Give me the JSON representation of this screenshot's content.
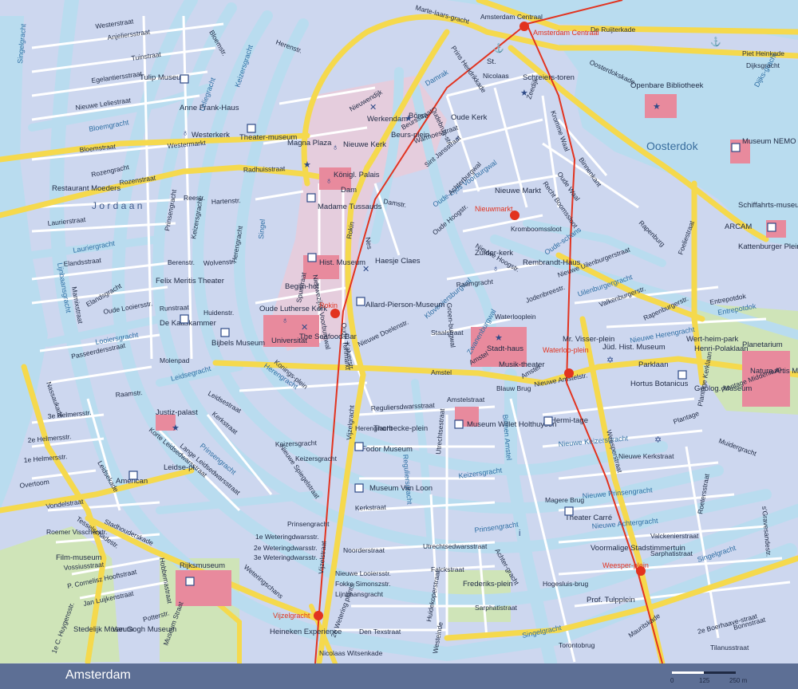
{
  "map_title": "Amsterdam",
  "colors": {
    "water": "#b9dcef",
    "block": "#cdd7ef",
    "street": "#ffffff",
    "main_road": "#f5d94d",
    "tram": "#e2331f",
    "park": "#cfe4b8",
    "landmark": "#e88a9d",
    "pedestrian": "#f0c9d6",
    "footer": "#5d6f95"
  },
  "scale": {
    "zero": "0",
    "mid": "125",
    "end": "250 m"
  },
  "districts": [
    {
      "id": "jordaan",
      "label": "J o r d a a n"
    },
    {
      "id": "oosterdok",
      "label": "Oosterdok"
    }
  ],
  "waterways": [
    {
      "id": "singelgracht-w",
      "label": "Singelgracht"
    },
    {
      "id": "lijnbaansgracht-w",
      "label": "Lijnbaansgracht"
    },
    {
      "id": "bloemgracht",
      "label": "Bloemgracht"
    },
    {
      "id": "lauriergracht",
      "label": "Lauriergracht"
    },
    {
      "id": "looiersgracht",
      "label": "Looiersgracht"
    },
    {
      "id": "leidsegracht",
      "label": "Leidsegracht"
    },
    {
      "id": "keizersgracht-w",
      "label": "Keizersgracht"
    },
    {
      "id": "prinsengracht-w",
      "label": "Prinsengracht"
    },
    {
      "id": "herengracht-w",
      "label": "Herengracht"
    },
    {
      "id": "singel",
      "label": "Singel"
    },
    {
      "id": "leliegracht",
      "label": "Leliegracht"
    },
    {
      "id": "damrak",
      "label": "Damrak"
    },
    {
      "id": "oz-voorburgwal",
      "label": "Oude-zijds Voorburgwal"
    },
    {
      "id": "kloveniersburgwal",
      "label": "Kloveniersburgwal"
    },
    {
      "id": "zwanenburgwal",
      "label": "Zwanenburgwal"
    },
    {
      "id": "binnenamstel",
      "label": "Binnen Amstel"
    },
    {
      "id": "reguliersgracht",
      "label": "Reguliersgracht"
    },
    {
      "id": "keizersgracht-e",
      "label": "Keizersgracht"
    },
    {
      "id": "prinsengracht-e",
      "label": "Prinsengracht"
    },
    {
      "id": "nieuwe-keizersgracht",
      "label": "Nieuwe Keizersgracht"
    },
    {
      "id": "nieuwe-prinsengracht",
      "label": "Nieuwe Prinsengracht"
    },
    {
      "id": "nieuwe-herengracht",
      "label": "Nieuwe Herengracht"
    },
    {
      "id": "nieuwe-achtergracht",
      "label": "Nieuwe Achtergracht"
    },
    {
      "id": "singelgracht-s",
      "label": "Singelgracht"
    },
    {
      "id": "singelgracht-e",
      "label": "Singelgracht"
    },
    {
      "id": "uilenburgergracht",
      "label": "Uilenburgergracht"
    },
    {
      "id": "entrepotdok",
      "label": "Entrepotdok"
    },
    {
      "id": "oudeschans",
      "label": "Oude-schans"
    },
    {
      "id": "dijksgracht",
      "label": "Dijks-gracht"
    }
  ],
  "streets": [
    {
      "id": "westerstraat",
      "label": "Westerstraat"
    },
    {
      "id": "anjeliersstraat",
      "label": "Anjeliersstraat"
    },
    {
      "id": "tuinstraat",
      "label": "Tuinstraat"
    },
    {
      "id": "egelantiersstraat",
      "label": "Egelantiersstraat"
    },
    {
      "id": "nieuwe-leliestraat",
      "label": "Nieuwe Leliestraat"
    },
    {
      "id": "bloemstraat",
      "label": "Bloemstraat"
    },
    {
      "id": "rozengracht",
      "label": "Rozengracht"
    },
    {
      "id": "rozenstraat",
      "label": "Rozenstraat"
    },
    {
      "id": "westermarkt",
      "label": "Westermarkt"
    },
    {
      "id": "radhuisstraat",
      "label": "Radhuisstraat"
    },
    {
      "id": "laurierstraat",
      "label": "Laurierstraat"
    },
    {
      "id": "elandsstraat",
      "label": "Elandsstraat"
    },
    {
      "id": "elandsgracht",
      "label": "Elandsgracht"
    },
    {
      "id": "oude-looiersstr",
      "label": "Oude Looiersstr."
    },
    {
      "id": "passeerdersstraat",
      "label": "Passeerdersstraat"
    },
    {
      "id": "marnixstraat",
      "label": "Marnixstraat"
    },
    {
      "id": "nassaukade",
      "label": "Nassaukade"
    },
    {
      "id": "overtoom",
      "label": "Overtoom"
    },
    {
      "id": "vondelstraat",
      "label": "Vondelstraat"
    },
    {
      "id": "tesselschadestr",
      "label": "Tesselschadestr."
    },
    {
      "id": "roemer-visscherstr",
      "label": "Roemer Visscherstr."
    },
    {
      "id": "vossiusstraat",
      "label": "Vossiusstraat"
    },
    {
      "id": "hooftstraat",
      "label": "P. Cornelisz Hooftstraat"
    },
    {
      "id": "luijkenstraat",
      "label": "Jan Luijkenstraat"
    },
    {
      "id": "potterstr",
      "label": "Potterstr."
    },
    {
      "id": "hobbemastraat",
      "label": "Hobbemastraat"
    },
    {
      "id": "stadhouderskade",
      "label": "Stadhouderskade"
    },
    {
      "id": "weteringschans",
      "label": "Weteringschans"
    },
    {
      "id": "museumstraat",
      "label": "Museum Straat"
    },
    {
      "id": "huygensstr",
      "label": "1e C. Huygensstr."
    },
    {
      "id": "helmerstr-3",
      "label": "3e Helmersstr."
    },
    {
      "id": "helmerstr-2",
      "label": "2e Helmersstr."
    },
    {
      "id": "helmerstr-1",
      "label": "1e Helmersstr."
    },
    {
      "id": "leidsekade",
      "label": "Leidsekade"
    },
    {
      "id": "korte-leidsedwarsstraat",
      "label": "Korte Leidsedwarsstraat"
    },
    {
      "id": "lange-leidsedwarsstraat",
      "label": "Lange Leidsedwarsstraat"
    },
    {
      "id": "kerkstraat-w",
      "label": "Kerkstraat"
    },
    {
      "id": "leidsestraat",
      "label": "Leidsestraat"
    },
    {
      "id": "nieuwe-spiegelstraat",
      "label": "Nieuwe Spiegelstraat"
    },
    {
      "id": "keizersgracht-street",
      "label": "Keizersgracht"
    },
    {
      "id": "molenpad",
      "label": "Molenpad"
    },
    {
      "id": "raamstr",
      "label": "Raamstr."
    },
    {
      "id": "runstraat",
      "label": "Runstraat"
    },
    {
      "id": "huidenstr",
      "label": "Huidenstr."
    },
    {
      "id": "wolvenstr",
      "label": "Wolvenstr."
    },
    {
      "id": "berenstr",
      "label": "Berenstr."
    },
    {
      "id": "hartenstr",
      "label": "Hartenstr."
    },
    {
      "id": "reestr",
      "label": "Reestr."
    },
    {
      "id": "prinsengracht-st",
      "label": "Prinsengracht"
    },
    {
      "id": "keizersgracht-st",
      "label": "Keizersgracht"
    },
    {
      "id": "herengracht-st",
      "label": "Herengracht"
    },
    {
      "id": "bloemstr",
      "label": "Bloemstr."
    },
    {
      "id": "herenstr",
      "label": "Herenstr."
    },
    {
      "id": "spuistraat",
      "label": "Spuistraat"
    },
    {
      "id": "nz-voorburgwal",
      "label": "Nieuwezijds Voorburgwal"
    },
    {
      "id": "rokin",
      "label": "Rokin"
    },
    {
      "id": "kalverstr",
      "label": "Kalverstr."
    },
    {
      "id": "koningsplein",
      "label": "Konings-plein"
    },
    {
      "id": "vijzelgracht",
      "label": "Vijzelgracht"
    },
    {
      "id": "vijzelstraat",
      "label": "Vijzelstraat"
    },
    {
      "id": "reguliersdwarsstraat",
      "label": "Reguliersdwarsstraat"
    },
    {
      "id": "herengracht-s",
      "label": "Herengracht"
    },
    {
      "id": "keizersgracht-s",
      "label": "Keizersgracht"
    },
    {
      "id": "kerkstraat",
      "label": "Kerkstraat"
    },
    {
      "id": "prinsengracht-s",
      "label": "Prinsengracht"
    },
    {
      "id": "noorderstraat",
      "label": "Noorderstraat"
    },
    {
      "id": "looiersstr",
      "label": "Nieuwe Looiersstr."
    },
    {
      "id": "simonszstr",
      "label": "Fokke Simonszstr."
    },
    {
      "id": "lijnbaansgracht",
      "label": "Lijnbaansgracht"
    },
    {
      "id": "weteringdwarsstr-1",
      "label": "1e Weteringdwarsstr."
    },
    {
      "id": "weteringdwarsstr-2",
      "label": "2e Weteringdwarsstr."
    },
    {
      "id": "weteringdwarsstr-3",
      "label": "3e Weteringdwarsstr."
    },
    {
      "id": "weteringplants",
      "label": "2e Wetering plants."
    },
    {
      "id": "den-texstraat",
      "label": "Den Texstraat"
    },
    {
      "id": "witsenkade",
      "label": "Nicolaas Witsenkade"
    },
    {
      "id": "amstelstraat",
      "label": "Amstelstraat"
    },
    {
      "id": "amstel",
      "label": "Amstel"
    },
    {
      "id": "utrechtsestraat",
      "label": "Utrechtsestraat"
    },
    {
      "id": "utrechtsedwarsstraat",
      "label": "Utrechtsedwarsstraat"
    },
    {
      "id": "falckstraat",
      "label": "Falckstraat"
    },
    {
      "id": "sarphatistraat",
      "label": "Sarphatistraat"
    },
    {
      "id": "huidekoperstraat",
      "label": "Huidekoperstraat"
    },
    {
      "id": "westeinde",
      "label": "Westeinde"
    },
    {
      "id": "torontobrug",
      "label": "Torontobrug"
    },
    {
      "id": "achtergracht",
      "label": "Achter-gracht"
    },
    {
      "id": "magere-brug",
      "label": "Magere Brug"
    },
    {
      "id": "hogesluis-brug",
      "label": "Hogesluis-brug"
    },
    {
      "id": "blauwbrug",
      "label": "Blauw Brug"
    },
    {
      "id": "weesperstraat",
      "label": "Weesperstraat"
    },
    {
      "id": "plantage",
      "label": "Plantage"
    },
    {
      "id": "plantage-middenlaan",
      "label": "Plantage Middenlaan"
    },
    {
      "id": "plantage-kerklaan",
      "label": "Plantage Kerklaan"
    },
    {
      "id": "muidergracht",
      "label": "Muidergracht"
    },
    {
      "id": "roetersstraat",
      "label": "Roetersstraat"
    },
    {
      "id": "valckenierstraat",
      "label": "Valckenierstraat"
    },
    {
      "id": "sarphatistraat-e",
      "label": "Sarphatistraat"
    },
    {
      "id": "mauritskade",
      "label": "Mauritskade"
    },
    {
      "id": "boerhaave",
      "label": "2e Boerhaave-straat"
    },
    {
      "id": "bonnstraat",
      "label": "Bonnstraat"
    },
    {
      "id": "tilanusstraat",
      "label": "Tilanusstraat"
    },
    {
      "id": "gravesandestr",
      "label": "s'Gravesandestr."
    },
    {
      "id": "nieuwe-kerkstraat",
      "label": "Nieuwe Kerkstraat"
    },
    {
      "id": "nieuwe-amstelstr",
      "label": "Nieuwe Amstelstr."
    },
    {
      "id": "amstel-w",
      "label": "Amstel"
    },
    {
      "id": "prins-hendrikkade",
      "label": "Prins Hendrikkade"
    },
    {
      "id": "de-ruijterkade",
      "label": "De Ruijterkade"
    },
    {
      "id": "piet-heinkade",
      "label": "Piet Heinkade"
    },
    {
      "id": "dijksgracht-st",
      "label": "Dijksgracht"
    },
    {
      "id": "oosterdokskade",
      "label": "Oosterdokskade"
    },
    {
      "id": "binnenkant",
      "label": "Binnenkant"
    },
    {
      "id": "oude-waal",
      "label": "Oude Waal"
    },
    {
      "id": "kromme-waal",
      "label": "Kromme Waal"
    },
    {
      "id": "recht-boomssloot",
      "label": "Recht Boomssloot"
    },
    {
      "id": "kromboomssloot",
      "label": "Kromboomssloot"
    },
    {
      "id": "rapenburg",
      "label": "Rapenburg"
    },
    {
      "id": "rapenburgerstr",
      "label": "Rapenburgerstr."
    },
    {
      "id": "valkenburgerstr",
      "label": "Valkenburgerstr."
    },
    {
      "id": "foeliestraat",
      "label": "Foeliestraat"
    },
    {
      "id": "nieuwe-uilenburgerstraat",
      "label": "Nieuwe Uilenburgerstraat"
    },
    {
      "id": "jodenbreestr",
      "label": "Jodenbreestr."
    },
    {
      "id": "waterlooplein",
      "label": "Waterlooplein"
    },
    {
      "id": "zeedijk",
      "label": "Zeedijk"
    },
    {
      "id": "damstr",
      "label": "Damstr."
    },
    {
      "id": "nes",
      "label": "Nes"
    },
    {
      "id": "warmoesstraat",
      "label": "Warmoesstraat"
    },
    {
      "id": "oudebrug",
      "label": "Oudebrug-str."
    },
    {
      "id": "beursstraat",
      "label": "Beursstraat"
    },
    {
      "id": "nieuwendijk",
      "label": "Nieuwendijk"
    },
    {
      "id": "sint-jansstraat",
      "label": "Sint Jansstraat"
    },
    {
      "id": "achterburgwal",
      "label": "Achterburgwal"
    },
    {
      "id": "oude-hoogstr",
      "label": "Oude Hoogstr."
    },
    {
      "id": "nieuwe-hoogstr",
      "label": "Nieuwe Hoogstr."
    },
    {
      "id": "raamgracht",
      "label": "Raamgracht"
    },
    {
      "id": "staalstraat",
      "label": "Staalstraat"
    },
    {
      "id": "groenburgwal",
      "label": "Groen-burgwal"
    },
    {
      "id": "nieuwe-doelenstr",
      "label": "Nieuwe Doelenstr."
    },
    {
      "id": "oude-turfmarkt",
      "label": "Oude Turfmarkt"
    },
    {
      "id": "amstel-n",
      "label": "Amstel"
    },
    {
      "id": "martelaarsgracht",
      "label": "Marte-laars-gracht"
    },
    {
      "id": "nicolaas",
      "label": "Nicolaas"
    },
    {
      "id": "entrepotdok-st",
      "label": "Entrepotdok"
    },
    {
      "id": "amsterdam-centraal",
      "label": "Amsterdam Centraal"
    }
  ],
  "landmarks": [
    {
      "id": "tulip-museum",
      "label": "Tulip Museum"
    },
    {
      "id": "anne-frank-haus",
      "label": "Anne Frank-Haus"
    },
    {
      "id": "westerkerk",
      "label": "Westerkerk"
    },
    {
      "id": "theatermuseum",
      "label": "Theater-museum"
    },
    {
      "id": "magna-plaza",
      "label": "Magna Plaza"
    },
    {
      "id": "nieuwe-kerk",
      "label": "Nieuwe Kerk"
    },
    {
      "id": "konigl-palais",
      "label": "Königl. Palais"
    },
    {
      "id": "dam",
      "label": "Dam"
    },
    {
      "id": "madame-tussauds",
      "label": "Madame Tussauds"
    },
    {
      "id": "werkendam",
      "label": "Werkendam"
    },
    {
      "id": "borse",
      "label": "Börse"
    },
    {
      "id": "beursplein",
      "label": "Beurs-plein"
    },
    {
      "id": "oude-kerk",
      "label": "Oude Kerk"
    },
    {
      "id": "st-nicolaas",
      "label": "St."
    },
    {
      "id": "schreierstoren",
      "label": "Schreiers-toren"
    },
    {
      "id": "openbare-bibliotheek",
      "label": "Openbare Bibliotheek"
    },
    {
      "id": "museum-nemo",
      "label": "Museum NEMO"
    },
    {
      "id": "nieuwmarkt",
      "label": "Nieuwe Markt"
    },
    {
      "id": "schiffahrtsmuseum",
      "label": "Schiffahrts-museum"
    },
    {
      "id": "arcam",
      "label": "ARCAM"
    },
    {
      "id": "kattenburger-plein",
      "label": "Kattenburger Plein"
    },
    {
      "id": "zuiderkerk",
      "label": "Zuider-kerk"
    },
    {
      "id": "rembrandthaus",
      "label": "Rembrandt-Haus"
    },
    {
      "id": "hist-museum",
      "label": "Hist. Museum"
    },
    {
      "id": "begijnhof",
      "label": "Begijn-hof"
    },
    {
      "id": "haesje-claes",
      "label": "Haesje Claes"
    },
    {
      "id": "allard-pierson",
      "label": "Allard-Pierson-Museum"
    },
    {
      "id": "oude-lutherse-kerk",
      "label": "Oude Lutherse Kerk"
    },
    {
      "id": "seafood-bar",
      "label": "The Seafood Bar"
    },
    {
      "id": "universitat",
      "label": "Universität"
    },
    {
      "id": "restaurant-moeders",
      "label": "Restaurant Moeders"
    },
    {
      "id": "felix-meritis",
      "label": "Felix Meritis Theater"
    },
    {
      "id": "de-kaaskammer",
      "label": "De Kaaskammer"
    },
    {
      "id": "bijbels-museum",
      "label": "Bijbels Museum"
    },
    {
      "id": "justizpalast",
      "label": "Justiz-palast"
    },
    {
      "id": "american",
      "label": "American"
    },
    {
      "id": "leidseplein",
      "label": "Leidse-pl."
    },
    {
      "id": "film-museum",
      "label": "Film-museum"
    },
    {
      "id": "rijksmuseum",
      "label": "Rijksmuseum"
    },
    {
      "id": "stedelijk-museum",
      "label": "Stedelijk Museum"
    },
    {
      "id": "van-gogh-museum",
      "label": "Van Gogh Museum"
    },
    {
      "id": "heineken-experience",
      "label": "Heineken Experience"
    },
    {
      "id": "fodor-museum",
      "label": "Fodor Museum"
    },
    {
      "id": "museum-van-loon",
      "label": "Museum Van Loon"
    },
    {
      "id": "thorbeckeplein",
      "label": "Thorbecke-plein"
    },
    {
      "id": "museum-willet",
      "label": "Museum Willet Holthuysen"
    },
    {
      "id": "hermitage",
      "label": "Hermi-tage"
    },
    {
      "id": "stadhaus",
      "label": "Stadt-haus"
    },
    {
      "id": "musiktheater",
      "label": "Musik-theater"
    },
    {
      "id": "mr-visserplein",
      "label": "Mr. Visser-plein"
    },
    {
      "id": "jud-hist-museum",
      "label": "Jüd. Hist. Museum"
    },
    {
      "id": "wertheimpark",
      "label": "Wert-heim-park"
    },
    {
      "id": "hortus-botanicus",
      "label": "Hortus Botanicus"
    },
    {
      "id": "parklaan",
      "label": "Parklaan"
    },
    {
      "id": "henri-polaklaan",
      "label": "Henri-Polaklaan"
    },
    {
      "id": "geolog-museum",
      "label": "Geolog. Museum"
    },
    {
      "id": "planetarium",
      "label": "Planetarium"
    },
    {
      "id": "natura-artis",
      "label": "Natura Artis Magistra"
    },
    {
      "id": "theater-carre",
      "label": "Theater Carré"
    },
    {
      "id": "voormalige-stadstimmertuin",
      "label": "Voormalige Stadstimmertuin"
    },
    {
      "id": "frederiksplein",
      "label": "Frederiks-plein"
    },
    {
      "id": "prof-tulpplein",
      "label": "Prof. Tulpplein"
    }
  ],
  "stations": [
    {
      "id": "centraal",
      "label": "Amsterdam Centraal"
    },
    {
      "id": "nieuwmarkt-st",
      "label": "Nieuwmarkt"
    },
    {
      "id": "rokin-st",
      "label": "Rokin"
    },
    {
      "id": "waterlooplein-st",
      "label": "Waterloo-plein"
    },
    {
      "id": "vijzelgracht-st",
      "label": "Vijzelgracht"
    },
    {
      "id": "weesperplein-st",
      "label": "Weesper-plein"
    }
  ]
}
